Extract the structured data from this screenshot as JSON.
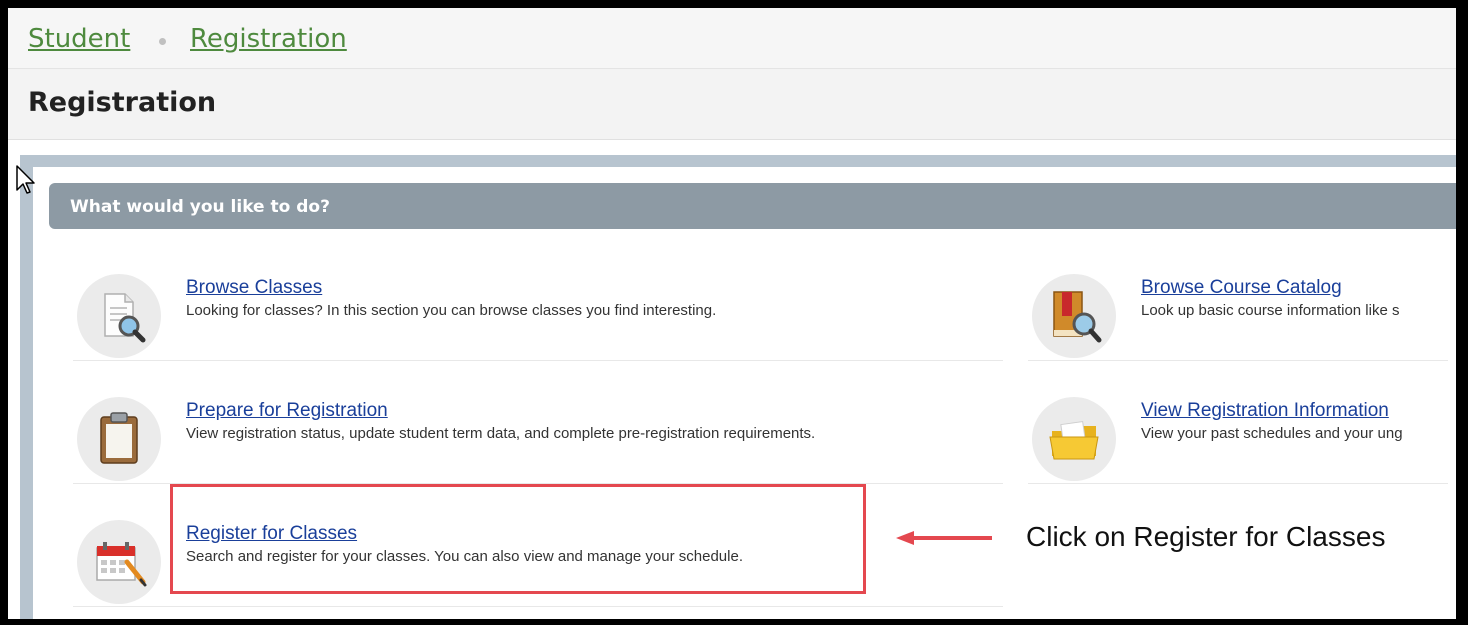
{
  "breadcrumb": {
    "items": [
      "Student",
      "Registration"
    ]
  },
  "page": {
    "title": "Registration"
  },
  "section": {
    "title": "What would you like to do?"
  },
  "options": [
    {
      "icon": "magnifier-document-icon",
      "link": "Browse Classes",
      "desc": "Looking for classes? In this section you can browse classes you find interesting."
    },
    {
      "icon": "book-search-icon",
      "link": "Browse Course Catalog",
      "desc": "Look up basic course information like s"
    },
    {
      "icon": "clipboard-icon",
      "link": "Prepare for Registration",
      "desc": "View registration status, update student term data, and complete pre-registration requirements."
    },
    {
      "icon": "folder-icon",
      "link": "View Registration Information",
      "desc": "View your past schedules and your ung"
    },
    {
      "icon": "calendar-pencil-icon",
      "link": "Register for Classes",
      "desc": "Search and register for your classes. You can also view and manage your schedule."
    }
  ],
  "annotation": {
    "text": "Click on Register for Classes",
    "color": "#e4484f"
  },
  "colors": {
    "link": "#1a3f9a",
    "breadcrumb": "#4e8a3e",
    "header": "#8d9aa4"
  }
}
